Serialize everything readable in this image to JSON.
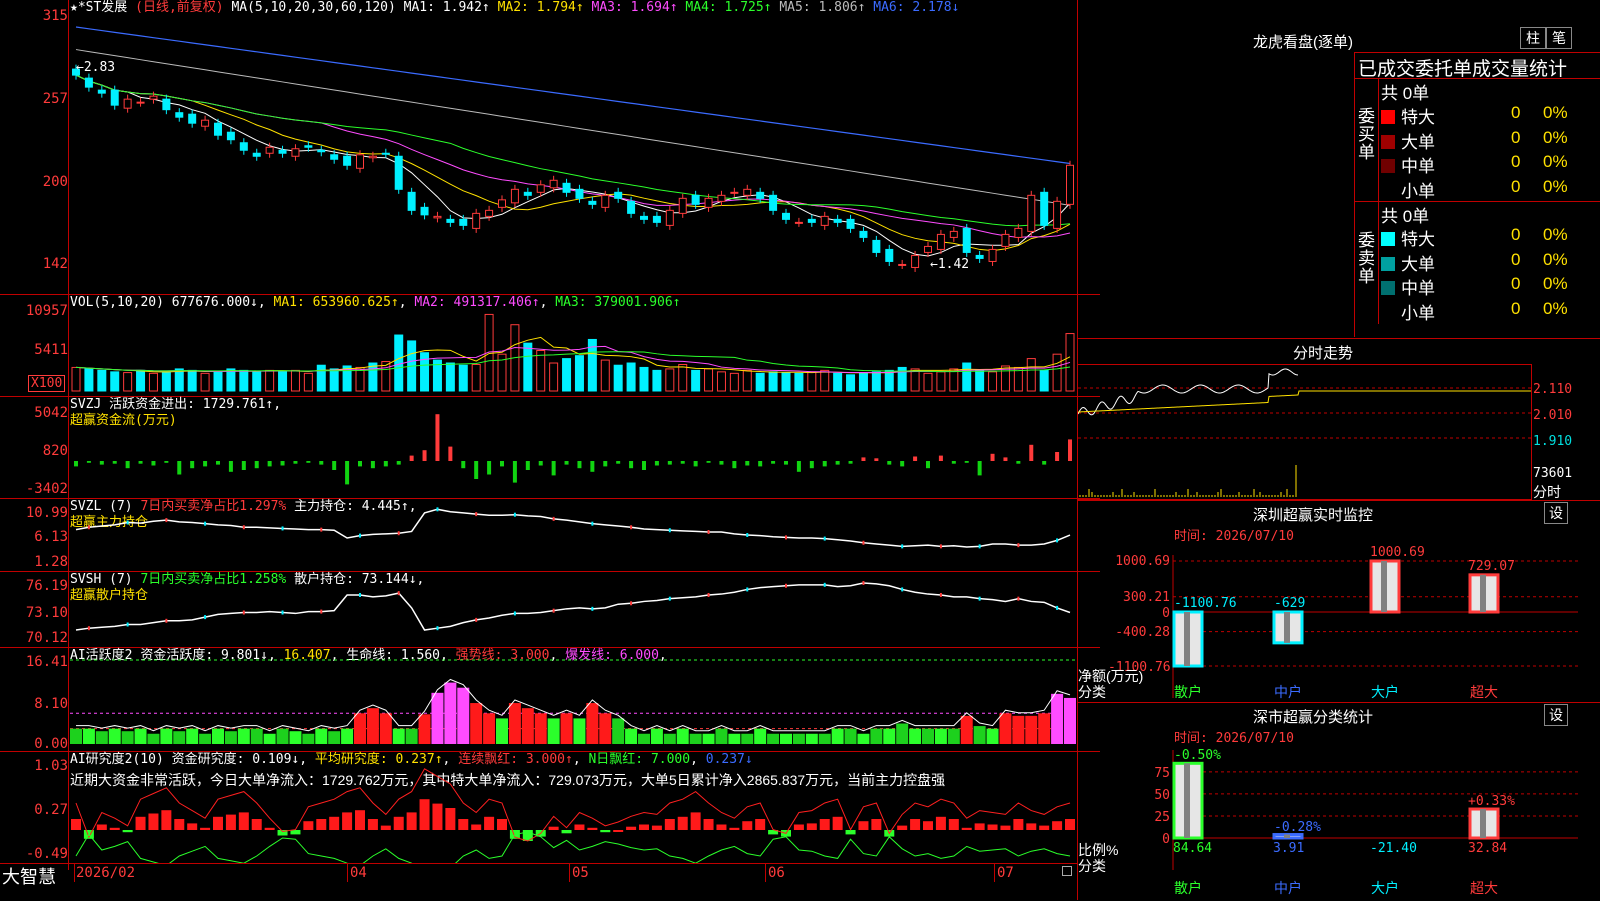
{
  "main": {
    "stock_label": "★*ST发展",
    "period_label": "(日线,前复权)",
    "ma_params": "MA(5,10,20,30,60,120)",
    "ma_values": [
      {
        "text": "MA1: 1.942↑",
        "color": "#ffffff"
      },
      {
        "text": "MA2: 1.794↑",
        "color": "#ffe100"
      },
      {
        "text": "MA3: 1.694↑",
        "color": "#ff4cff"
      },
      {
        "text": "MA4: 1.725↑",
        "color": "#2bff2b"
      },
      {
        "text": "MA5: 1.806↑",
        "color": "#bbbbbb"
      },
      {
        "text": "MA6: 2.178↓",
        "color": "#3b6bff"
      }
    ],
    "axis": [
      "315",
      "257",
      "200",
      "142"
    ],
    "high_label": "←2.83",
    "low_label": "←1.42",
    "closes": [
      2.78,
      2.7,
      2.66,
      2.58,
      2.62,
      2.6,
      2.64,
      2.55,
      2.5,
      2.46,
      2.48,
      2.38,
      2.35,
      2.28,
      2.24,
      2.3,
      2.26,
      2.29,
      2.3,
      2.27,
      2.22,
      2.18,
      2.25,
      2.24,
      2.26,
      2.02,
      1.88,
      1.85,
      1.84,
      1.8,
      1.78,
      1.86,
      1.88,
      1.95,
      2.02,
      1.98,
      2.05,
      2.08,
      2.0,
      1.96,
      1.92,
      1.98,
      1.96,
      1.86,
      1.82,
      1.8,
      1.88,
      1.96,
      1.92,
      1.96,
      1.98,
      2.0,
      2.02,
      1.96,
      1.88,
      1.82,
      1.8,
      1.8,
      1.84,
      1.8,
      1.76,
      1.7,
      1.6,
      1.54,
      1.52,
      1.58,
      1.64,
      1.72,
      1.74,
      1.6,
      1.56,
      1.62,
      1.72,
      1.76,
      1.98,
      1.78,
      1.94,
      2.18
    ]
  },
  "vol": {
    "header_prefix": "VOL(5,10,20)",
    "value": "677676.000↓",
    "ma1": "MA1: 653960.625↑",
    "ma2": "MA2: 491317.406↑",
    "ma3": "MA3: 379001.906↑",
    "axis": [
      "10957",
      "5411"
    ],
    "multiplier": "X100",
    "values": [
      3.2,
      3.0,
      2.8,
      2.6,
      2.5,
      2.8,
      2.4,
      2.6,
      3.0,
      2.8,
      2.4,
      2.6,
      3.0,
      2.8,
      2.6,
      2.8,
      2.6,
      2.8,
      2.4,
      3.5,
      3.0,
      3.4,
      3.2,
      3.8,
      4.0,
      7.6,
      6.8,
      5.2,
      4.2,
      3.8,
      3.5,
      3.6,
      10.4,
      5.0,
      9.0,
      6.5,
      5.5,
      3.8,
      4.4,
      4.8,
      7.0,
      4.2,
      3.5,
      3.8,
      3.2,
      2.8,
      3.0,
      3.6,
      2.8,
      3.0,
      2.6,
      2.4,
      2.8,
      2.4,
      2.6,
      2.5,
      2.4,
      2.6,
      2.8,
      2.4,
      2.2,
      2.4,
      2.6,
      2.8,
      3.2,
      3.0,
      2.4,
      2.6,
      3.0,
      3.8,
      2.8,
      2.6,
      3.4,
      3.2,
      4.4,
      2.8,
      5.0,
      7.8
    ]
  },
  "svzj": {
    "name": "SVZJ",
    "desc": "活跃资金进出: 1729.761↑,",
    "sub": "超赢资金流(万元)",
    "axis": [
      "5042",
      "820",
      "-3402"
    ],
    "values": [
      -0.6,
      -0.2,
      -0.4,
      -0.3,
      -0.8,
      -0.3,
      -0.5,
      -0.2,
      -1.5,
      -0.8,
      -0.6,
      -0.4,
      -1.2,
      -1.0,
      -0.8,
      -0.6,
      -0.5,
      -0.3,
      -0.2,
      -0.4,
      -1.0,
      -2.6,
      -0.6,
      -0.8,
      -0.6,
      -0.4,
      0.6,
      1.2,
      5.2,
      1.6,
      -0.8,
      -2.0,
      -1.5,
      -0.6,
      -2.4,
      -1.0,
      -0.5,
      -1.6,
      -0.4,
      -0.8,
      -1.2,
      -0.6,
      -0.3,
      -0.8,
      -1.0,
      -0.5,
      -0.4,
      -0.3,
      -0.6,
      -0.2,
      -0.4,
      -0.8,
      -0.5,
      -0.6,
      -0.3,
      -0.4,
      -1.2,
      -0.8,
      -0.6,
      -0.4,
      -0.3,
      0.4,
      0.3,
      -0.4,
      -0.6,
      0.5,
      -0.8,
      0.6,
      -0.3,
      -0.2,
      -1.6,
      0.8,
      0.4,
      -0.3,
      1.8,
      -0.4,
      1.0,
      2.4
    ]
  },
  "svzl": {
    "name": "SVZL (7)",
    "ratio": "7日内买卖净占比1.297%",
    "holding": "主力持仓: 4.445↑,",
    "sub": "超赢主力持仓",
    "axis": [
      "10.99",
      "6.13",
      "1.28"
    ],
    "values": [
      7.2,
      7.6,
      7.8,
      8.0,
      8.4,
      8.3,
      8.6,
      8.8,
      8.5,
      8.4,
      8.2,
      8.0,
      7.9,
      7.6,
      7.6,
      7.5,
      7.4,
      7.3,
      7.2,
      7.2,
      7.1,
      5.8,
      6.2,
      6.4,
      6.5,
      6.6,
      6.9,
      10.0,
      10.6,
      10.2,
      10.0,
      9.8,
      9.6,
      9.6,
      9.7,
      9.5,
      9.4,
      9.0,
      8.8,
      8.5,
      8.2,
      8.0,
      7.8,
      7.6,
      7.3,
      7.2,
      7.1,
      7.0,
      6.9,
      6.8,
      6.8,
      6.5,
      6.3,
      6.2,
      6.0,
      5.9,
      5.8,
      5.8,
      5.7,
      5.5,
      5.3,
      5.0,
      4.8,
      4.6,
      4.4,
      4.5,
      4.6,
      4.4,
      4.5,
      4.3,
      4.4,
      4.8,
      4.8,
      4.6,
      4.6,
      4.8,
      5.4,
      6.3
    ]
  },
  "svsh": {
    "name": "SVSH (7)",
    "ratio": "7日内买卖净占比1.258%",
    "holding": "散户持仓: 73.144↓,",
    "sub": "超赢散户持仓",
    "axis": [
      "76.19",
      "73.10",
      "70.12"
    ],
    "values": [
      71.2,
      71.4,
      71.5,
      71.6,
      71.8,
      71.8,
      72.0,
      72.2,
      72.2,
      72.3,
      72.6,
      72.9,
      73.0,
      73.1,
      73.1,
      73.2,
      73.1,
      73.0,
      73.2,
      73.2,
      73.3,
      75.0,
      75.0,
      74.8,
      74.9,
      75.2,
      73.6,
      71.2,
      71.4,
      71.6,
      72.0,
      72.3,
      72.5,
      72.8,
      73.0,
      73.0,
      73.1,
      73.3,
      73.5,
      73.6,
      73.5,
      73.6,
      74.0,
      74.1,
      74.3,
      74.4,
      74.6,
      74.7,
      74.8,
      75.0,
      75.1,
      75.3,
      75.6,
      75.8,
      75.9,
      76.0,
      76.1,
      76.1,
      76.1,
      75.9,
      76.0,
      76.3,
      76.2,
      76.0,
      75.6,
      75.3,
      75.1,
      75.0,
      74.8,
      74.8,
      74.6,
      74.5,
      74.3,
      74.6,
      74.3,
      74.2,
      73.6,
      73.1
    ]
  },
  "ai2": {
    "name": "AI活跃度2",
    "activity": "资金活跃度: 9.801↓",
    "v2": "16.407",
    "life": "生命线: 1.560",
    "strong": "强势线: 3.000",
    "burst": "爆发线: 6.000",
    "axis": [
      "16.41",
      "8.10",
      "0.00"
    ],
    "values": [
      3,
      3,
      2.5,
      3,
      2.5,
      3,
      2,
      3,
      2.5,
      3,
      2,
      3,
      2.5,
      3,
      3,
      2,
      3,
      2.5,
      2,
      3,
      2.5,
      3,
      6,
      7,
      6,
      3,
      3,
      5.8,
      10,
      12,
      11,
      8,
      6,
      5,
      8,
      7,
      6,
      5,
      6,
      5,
      8,
      6,
      5,
      3,
      2,
      3,
      2,
      3,
      2,
      2,
      3,
      2,
      2,
      3,
      2,
      2,
      2,
      2,
      2,
      3,
      3,
      2,
      3,
      3,
      4,
      3,
      3,
      3,
      3,
      5.5,
      3.5,
      3,
      6,
      5.5,
      5.5,
      6,
      9.8,
      9
    ]
  },
  "ai_research": {
    "name": "AI研究度2(10)",
    "degree": "资金研究度: 0.109↓",
    "avg": "平均研究度: 0.237↑",
    "streak": "连续飘红: 3.000↑",
    "nday": "N日飘红: 7.000",
    "last": "0.237↓",
    "comment": "近期大资金非常活跃，今日大单净流入：1729.762万元，其中特大单净流入：729.073万元，大单5日累计净入2865.837万元，当前主力控盘强",
    "axis": [
      "1.03",
      "0.27",
      "-0.49"
    ],
    "values": [
      0.1,
      -0.08,
      0.05,
      0.02,
      -0.02,
      0.12,
      0.15,
      0.18,
      0.1,
      0.06,
      0.02,
      0.12,
      0.14,
      0.16,
      0.1,
      0.02,
      -0.05,
      -0.04,
      0.08,
      0.1,
      0.12,
      0.16,
      0.18,
      0.1,
      0.04,
      0.12,
      0.16,
      0.28,
      0.24,
      0.2,
      0.1,
      0.05,
      0.12,
      0.1,
      -0.08,
      -0.1,
      -0.06,
      0.03,
      -0.03,
      0.05,
      0.02,
      -0.02,
      0.0,
      0.03,
      0.05,
      0.04,
      0.1,
      0.12,
      0.16,
      0.1,
      0.05,
      0.02,
      0.08,
      0.1,
      -0.04,
      -0.06,
      0.05,
      0.06,
      0.1,
      0.12,
      -0.04,
      0.08,
      0.1,
      -0.06,
      0.04,
      0.1,
      0.08,
      0.12,
      0.1,
      0.02,
      0.06,
      0.05,
      0.04,
      0.1,
      0.06,
      0.04,
      0.08,
      0.1
    ]
  },
  "dates": [
    "2026/02",
    "04",
    "05",
    "06",
    "07"
  ],
  "brand": "大智慧",
  "right": {
    "lhkp_title": "龙虎看盘(逐单)",
    "btn_zhu": "柱",
    "btn_bi": "笔",
    "stats_title": "已成交委托单成交量统计",
    "buy_label": "委买单",
    "sell_label": "委卖单",
    "buy_total": "共 0单",
    "sell_total": "共 0单",
    "buy_rows": [
      {
        "label": "特大",
        "v": "0",
        "p": "0%",
        "color": "#ff0000"
      },
      {
        "label": "大单",
        "v": "0",
        "p": "0%",
        "color": "#a00000"
      },
      {
        "label": "中单",
        "v": "0",
        "p": "0%",
        "color": "#700000"
      },
      {
        "label": "小单",
        "v": "0",
        "p": "0%",
        "color": "#000000"
      }
    ],
    "sell_rows": [
      {
        "label": "特大",
        "v": "0",
        "p": "0%",
        "color": "#00ffff"
      },
      {
        "label": "大单",
        "v": "0",
        "p": "0%",
        "color": "#00a0a0"
      },
      {
        "label": "中单",
        "v": "0",
        "p": "0%",
        "color": "#007070"
      },
      {
        "label": "小单",
        "v": "0",
        "p": "0%",
        "color": "#000000"
      }
    ],
    "fs_title": "分时走势",
    "fs_axis": [
      "2.110",
      "2.010",
      "1.910"
    ],
    "fs_vol": "73601",
    "fs_label": "分时",
    "sz_title": "深圳超赢实时监控",
    "sz_btn": "设",
    "sz_time": "时间: 2026/07/10",
    "sz_axis": [
      "1000.69",
      "300.21",
      "0",
      "-400.28",
      "-1100.76"
    ],
    "sz_ylabel": "净额(万元)",
    "sz_xlabel": "分类",
    "sc_title": "深市超赢分类统计",
    "sc_btn": "设",
    "sc_time": "时间: 2026/07/10",
    "sc_axis": [
      "75",
      "50",
      "25",
      "0"
    ],
    "sc_ylabel": "比例%",
    "sc_xlabel": "分类",
    "sc_bottom": [
      "84.64",
      "3.91",
      "-21.40",
      "32.84"
    ]
  },
  "chart_data": [
    {
      "type": "bar",
      "title": "深圳超赢实时监控",
      "categories": [
        "散户",
        "中户",
        "大户",
        "超大"
      ],
      "values": [
        -1100.76,
        -629,
        1000.69,
        729.07
      ],
      "labels": [
        "-1100.76",
        "-629",
        "1000.69",
        "729.07"
      ],
      "ylabel": "净额(万元)",
      "ylim": [
        -1100.76,
        1000.69
      ],
      "ticks": [
        1000.69,
        300.21,
        0,
        -400.28,
        -1100.76
      ]
    },
    {
      "type": "bar",
      "title": "深市超赢分类统计",
      "categories": [
        "散户",
        "中户",
        "大户",
        "超大"
      ],
      "values": [
        84.64,
        3.91,
        -21.4,
        32.84
      ],
      "labels": [
        "-0.50%",
        "-0.28%",
        "",
        "+0.33%"
      ],
      "ylabel": "比例%",
      "ylim": [
        0,
        85
      ],
      "ticks": [
        75,
        50,
        25,
        0
      ]
    }
  ]
}
